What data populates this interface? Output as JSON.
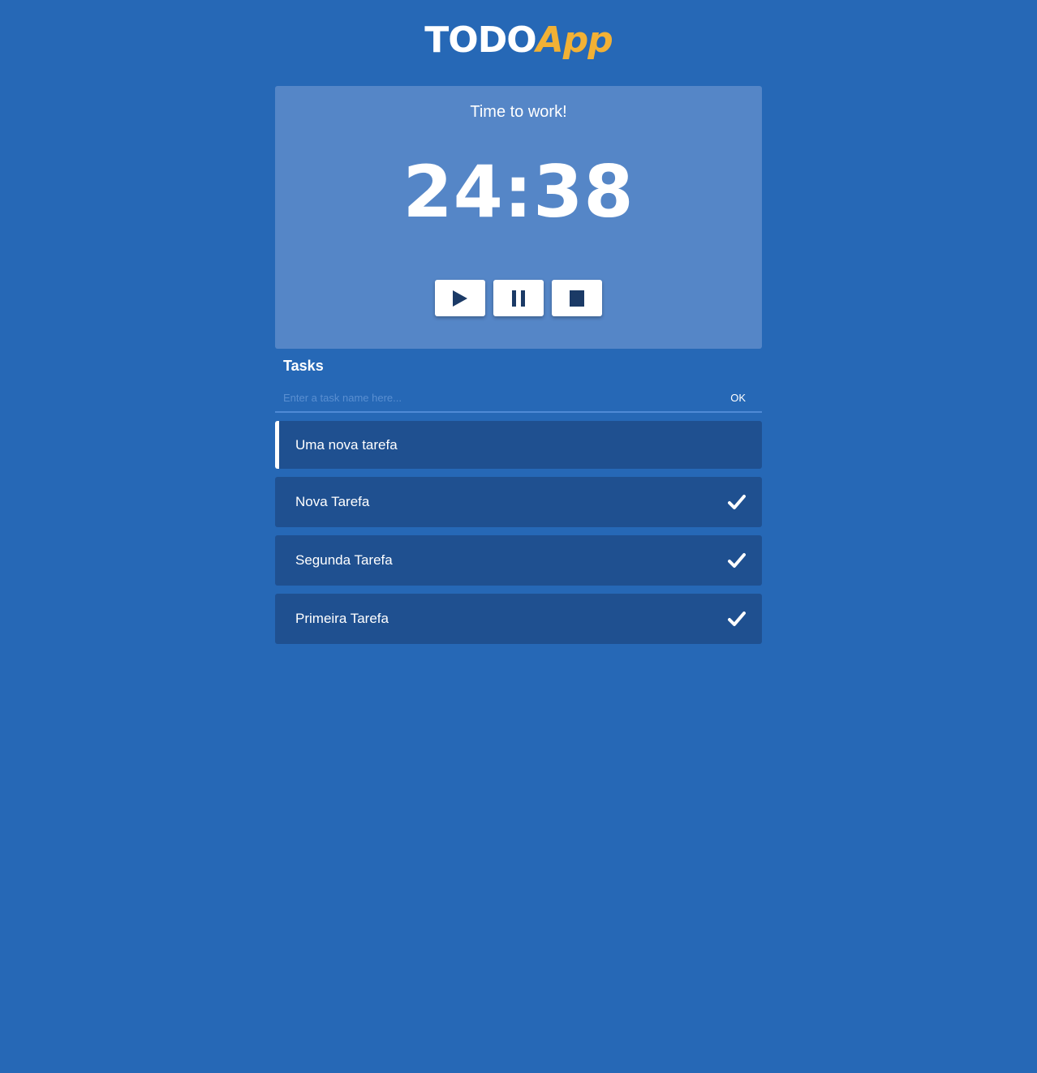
{
  "header": {
    "logo_main": "TODO",
    "logo_accent": "App"
  },
  "timer": {
    "status": "Time to work!",
    "display": "24:38",
    "controls": [
      {
        "name": "play",
        "icon": "play-icon"
      },
      {
        "name": "pause",
        "icon": "pause-icon"
      },
      {
        "name": "stop",
        "icon": "stop-icon"
      }
    ]
  },
  "tasks": {
    "title": "Tasks",
    "input_placeholder": "Enter a task name here...",
    "input_value": "",
    "ok_label": "OK",
    "items": [
      {
        "label": "Uma nova tarefa",
        "done": false,
        "active": true
      },
      {
        "label": "Nova Tarefa",
        "done": true,
        "active": false
      },
      {
        "label": "Segunda Tarefa",
        "done": true,
        "active": false
      },
      {
        "label": "Primeira Tarefa",
        "done": true,
        "active": false
      }
    ]
  },
  "colors": {
    "background": "#2668b6",
    "timer_card": "#5586c7",
    "task_item": "#1f5090",
    "accent": "#f2b135",
    "icon": "#1b3a66"
  }
}
